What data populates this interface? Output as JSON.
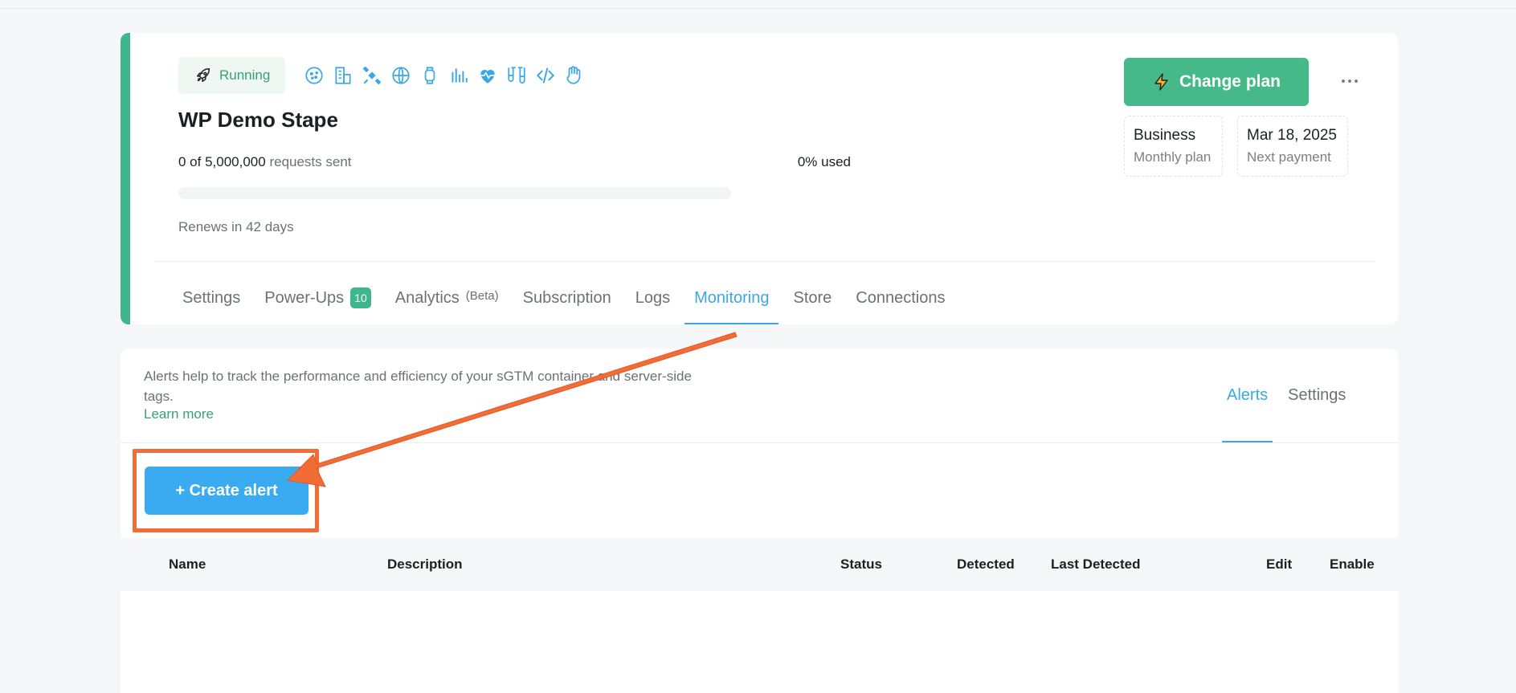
{
  "container": {
    "status": "Running",
    "name": "WP Demo Stape",
    "usage": {
      "requests_used": "0 of 5,000,000",
      "requests_suffix": "requests sent",
      "percent_used": "0% used",
      "fraction": 0
    },
    "renews": "Renews in 42 days",
    "powerup_icons": [
      "cookie-icon",
      "building-icon",
      "satellite-icon",
      "globe-icon",
      "wearable-icon",
      "bars-icon",
      "heartbeat-icon",
      "flask-icon",
      "code-icon",
      "hand-icon"
    ]
  },
  "plan": {
    "change_plan_label": "Change plan",
    "plan_name": "Business",
    "plan_period": "Monthly plan",
    "next_payment_date": "Mar 18, 2025",
    "next_payment_label": "Next payment"
  },
  "tabs": [
    {
      "label": "Settings"
    },
    {
      "label": "Power-Ups",
      "badge": "10"
    },
    {
      "label": "Analytics",
      "beta": "(Beta)"
    },
    {
      "label": "Subscription"
    },
    {
      "label": "Logs"
    },
    {
      "label": "Monitoring",
      "active": true
    },
    {
      "label": "Store"
    },
    {
      "label": "Connections"
    }
  ],
  "monitoring": {
    "description": "Alerts help to track the performance and efficiency of your sGTM container and server-side tags.",
    "learn_more": "Learn more",
    "sub_tabs": [
      {
        "label": "Alerts",
        "active": true
      },
      {
        "label": "Settings"
      }
    ],
    "create_alert_label": "+ Create alert",
    "columns": [
      "Name",
      "Description",
      "Status",
      "Detected",
      "Last Detected",
      "Edit",
      "Enable"
    ]
  },
  "colors": {
    "accent_green": "#3fb68b",
    "accent_blue": "#3aa8e6",
    "annotation_orange": "#f26c36"
  }
}
